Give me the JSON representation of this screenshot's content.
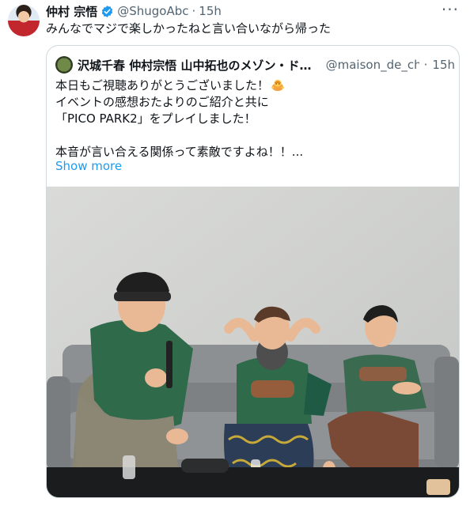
{
  "tweet": {
    "display_name": "仲村 宗悟",
    "handle": "@ShugoAbc",
    "separator": "·",
    "time": "15h",
    "more_label": "···",
    "text": "みんなでマジで楽しかったねと言い合いながら帰った"
  },
  "quote": {
    "display_name": "沢城千春 仲村宗悟 山中拓也のメゾン・ド・カ",
    "handle": "@maison_de_chac",
    "separator": "·",
    "time": "15h",
    "lines": [
      "本日もご視聴ありがとうございました！",
      "イベントの感想おたよりのご紹介と共に",
      "「PICO PARK2」をプレイしました！",
      "",
      "本音が言い合える関係って素敵ですよね！！..."
    ],
    "show_more": "Show more"
  },
  "colors": {
    "link": "#1d9bf0",
    "verified": "#1d9bf0",
    "secondary_text": "#536471",
    "border": "#cfd9de"
  },
  "icons": {
    "verified": "verified-badge-icon",
    "more": "more-dots-icon",
    "emoji": "bowing-person-emoji"
  }
}
